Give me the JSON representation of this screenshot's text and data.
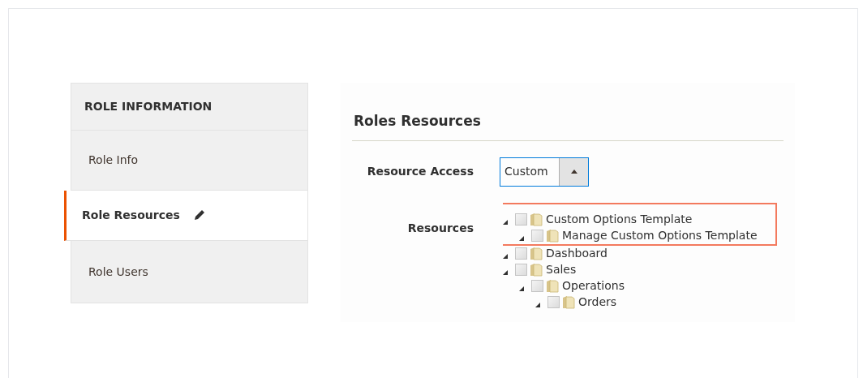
{
  "sidebar": {
    "title": "ROLE INFORMATION",
    "items": [
      {
        "label": "Role Info",
        "selected": false,
        "edited": false
      },
      {
        "label": "Role Resources",
        "selected": true,
        "edited": true
      },
      {
        "label": "Role Users",
        "selected": false,
        "edited": false
      }
    ]
  },
  "section": {
    "title": "Roles Resources",
    "resource_access": {
      "label": "Resource Access",
      "value": "Custom"
    },
    "resources": {
      "label": "Resources",
      "tree": [
        {
          "label": "Custom Options Template",
          "checked": false,
          "expanded": true,
          "highlighted": true,
          "children": [
            {
              "label": "Manage Custom Options Template",
              "checked": false,
              "expanded": true,
              "highlighted": false
            }
          ]
        },
        {
          "label": "Dashboard",
          "checked": false,
          "expanded": true,
          "highlighted": false
        },
        {
          "label": "Sales",
          "checked": false,
          "expanded": true,
          "highlighted": false,
          "children": [
            {
              "label": "Operations",
              "checked": false,
              "expanded": true,
              "highlighted": false,
              "children": [
                {
                  "label": "Orders",
                  "checked": false,
                  "expanded": true,
                  "highlighted": false
                }
              ]
            }
          ]
        }
      ]
    }
  }
}
